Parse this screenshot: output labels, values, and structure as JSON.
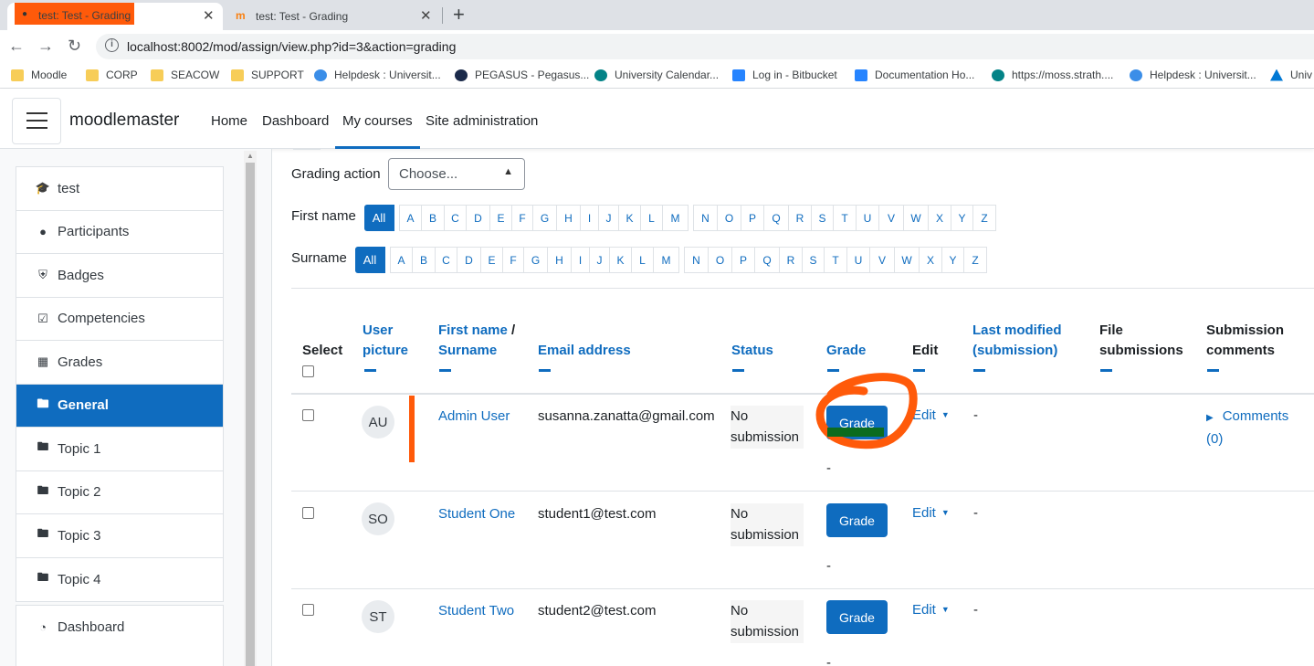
{
  "browser": {
    "tabs": [
      {
        "title": "test: Test - Grading"
      },
      {
        "title": "test: Test - Grading"
      }
    ],
    "url": "localhost:8002/mod/assign/view.php?id=3&action=grading",
    "bookmarks": [
      {
        "label": "Moodle",
        "icon": "folder-icon"
      },
      {
        "label": "CORP",
        "icon": "folder-icon"
      },
      {
        "label": "SEACOW",
        "icon": "folder-icon"
      },
      {
        "label": "SUPPORT",
        "icon": "folder-icon"
      },
      {
        "label": "Helpdesk : Universit...",
        "icon": "helpdesk-icon"
      },
      {
        "label": "PEGASUS - Pegasus...",
        "icon": "pegasus-icon"
      },
      {
        "label": "University Calendar...",
        "icon": "sharepoint-icon"
      },
      {
        "label": "Log in - Bitbucket",
        "icon": "bitbucket-icon"
      },
      {
        "label": "Documentation Ho...",
        "icon": "confluence-icon"
      },
      {
        "label": "https://moss.strath....",
        "icon": "sharepoint-icon"
      },
      {
        "label": "Helpdesk : Universit...",
        "icon": "helpdesk-icon"
      },
      {
        "label": "Univ",
        "icon": "azure-icon"
      }
    ]
  },
  "navbar": {
    "brand": "moodlemaster",
    "links": [
      "Home",
      "Dashboard",
      "My courses",
      "Site administration"
    ],
    "active_link": "My courses"
  },
  "sidebar": {
    "items": [
      {
        "label": "test",
        "icon": "graduation-cap-icon"
      },
      {
        "label": "Participants",
        "icon": "users-icon"
      },
      {
        "label": "Badges",
        "icon": "shield-icon"
      },
      {
        "label": "Competencies",
        "icon": "checkbox-icon"
      },
      {
        "label": "Grades",
        "icon": "table-icon"
      },
      {
        "label": "General",
        "icon": "folder-icon",
        "active": true
      },
      {
        "label": "Topic 1",
        "icon": "folder-icon"
      },
      {
        "label": "Topic 2",
        "icon": "folder-icon"
      },
      {
        "label": "Topic 3",
        "icon": "folder-icon"
      },
      {
        "label": "Topic 4",
        "icon": "folder-icon"
      }
    ],
    "items2": [
      {
        "label": "Dashboard",
        "icon": "dashboard-icon"
      }
    ]
  },
  "grading": {
    "action_label": "Grading action",
    "action_value": "Choose...",
    "firstname_label": "First name",
    "surname_label": "Surname",
    "all_label": "All",
    "letters": [
      "A",
      "B",
      "C",
      "D",
      "E",
      "F",
      "G",
      "H",
      "I",
      "J",
      "K",
      "L",
      "M",
      "N",
      "O",
      "P",
      "Q",
      "R",
      "S",
      "T",
      "U",
      "V",
      "W",
      "X",
      "Y",
      "Z"
    ]
  },
  "table": {
    "headers": {
      "select": "Select",
      "user_picture_1": "User",
      "user_picture_2": "picture",
      "first_name": "First name",
      "slash": " /",
      "surname": "Surname",
      "email": "Email address",
      "status": "Status",
      "grade": "Grade",
      "edit": "Edit",
      "last_modified_1": "Last modified",
      "last_modified_2": "(submission)",
      "file_sub_1": "File",
      "file_sub_2": "submissions",
      "sub_comments_1": "Submission",
      "sub_comments_2": "comments"
    },
    "rows": [
      {
        "initials": "AU",
        "name": "Admin User",
        "email": "susanna.zanatta@gmail.com",
        "status_1": "No",
        "status_2": "submission",
        "grade_btn": "Grade",
        "grade_value": "-",
        "edit": "Edit",
        "last_modified": "-",
        "comments": "Comments",
        "comments_count": "(0)"
      },
      {
        "initials": "SO",
        "name": "Student One",
        "email": "student1@test.com",
        "status_1": "No",
        "status_2": "submission",
        "grade_btn": "Grade",
        "grade_value": "-",
        "edit": "Edit",
        "last_modified": "-"
      },
      {
        "initials": "ST",
        "name": "Student Two",
        "email": "student2@test.com",
        "status_1": "No",
        "status_2": "submission",
        "grade_btn": "Grade",
        "grade_value": "-",
        "edit": "Edit",
        "last_modified": "-"
      }
    ]
  },
  "colors": {
    "primary": "#0f6cbf",
    "annotation": "#ff5a0a"
  }
}
